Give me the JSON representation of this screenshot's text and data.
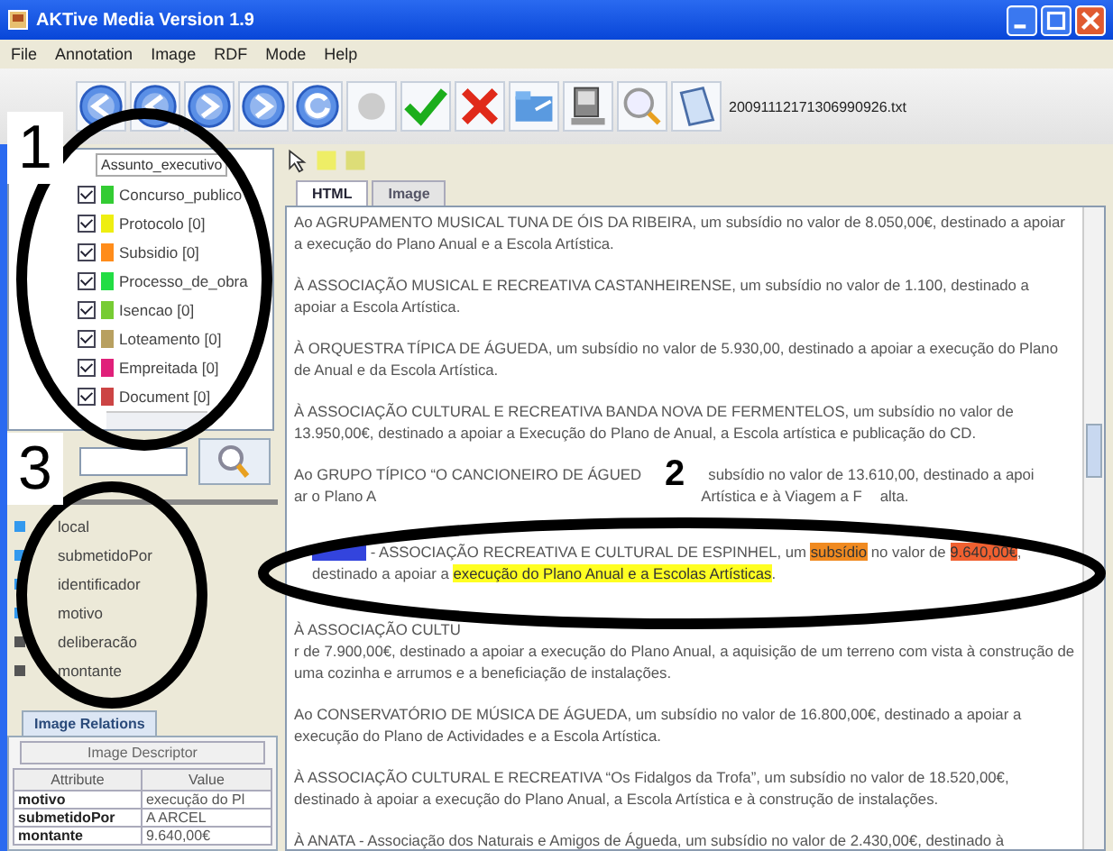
{
  "window": {
    "title": "AKTive Media Version 1.9"
  },
  "menu": [
    "File",
    "Annotation",
    "Image",
    "RDF",
    "Mode",
    "Help"
  ],
  "toolbar": {
    "filename": "20091112171306990926.txt"
  },
  "tree": {
    "header": "Assunto_executivo",
    "items": [
      {
        "label": "Concurso_publico",
        "checked": true,
        "color": "#33cc33"
      },
      {
        "label": "Protocolo [0]",
        "checked": true,
        "color": "#eeee11"
      },
      {
        "label": "Subsidio [0]",
        "checked": true,
        "color": "#ff8c1a"
      },
      {
        "label": "Processo_de_obra",
        "checked": true,
        "color": "#22dd44"
      },
      {
        "label": "Isencao [0]",
        "checked": true,
        "color": "#77cc33"
      },
      {
        "label": "Loteamento [0]",
        "checked": true,
        "color": "#b8a060"
      },
      {
        "label": "Empreitada [0]",
        "checked": true,
        "color": "#e0207a"
      },
      {
        "label": "Document [0]",
        "checked": true,
        "color": "#cc4444"
      }
    ]
  },
  "attributes": [
    {
      "label": "local",
      "color": "#3399ee"
    },
    {
      "label": "submetidoPor",
      "color": "#3399ee"
    },
    {
      "label": "identificador",
      "color": "#3399ee"
    },
    {
      "label": "motivo",
      "color": "#3399ee"
    },
    {
      "label": "deliberacão",
      "color": "#555555"
    },
    {
      "label": "montante",
      "color": "#555555"
    }
  ],
  "relations": {
    "tab": "Image Relations",
    "button": "Image Descriptor",
    "columns": [
      "Attribute",
      "Value"
    ],
    "rows": [
      [
        "motivo",
        "execução do Pl"
      ],
      [
        "submetidoPor",
        "A ARCEL"
      ],
      [
        "montante",
        "9.640,00€"
      ]
    ]
  },
  "tabs": [
    {
      "label": "HTML",
      "selected": true
    },
    {
      "label": "Image",
      "selected": false
    }
  ],
  "paragraphs": [
    {
      "kind": "plain",
      "text": "Ao AGRUPAMENTO MUSICAL TUNA DE ÓIS DA RIBEIRA, um subsídio no valor de 8.050,00€, destinado a apoiar a execução do Plano Anual e a Escola Artística."
    },
    {
      "kind": "plain",
      "text": "À ASSOCIAÇÃO MUSICAL E RECREATIVA CASTANHEIRENSE, um subsídio no valor de 1.100, destinado a apoiar a Escola Artística."
    },
    {
      "kind": "plain",
      "text": "À ORQUESTRA TÍPICA DE ÁGUEDA, um subsídio no valor de 5.930,00, destinado a apoiar a execução do Plano de Anual e da Escola Artística."
    },
    {
      "kind": "plain",
      "text": "À ASSOCIAÇÃO CULTURAL E RECREATIVA BANDA NOVA DE FERMENTELOS, um subsídio no valor de 13.950,00€, destinado a apoiar a Execução do Plano de Anual, a Escola artística e publicação do CD."
    },
    {
      "kind": "lines",
      "lines": [
        [
          {
            "kind": "text",
            "text": "Ao GRUPO TÍPICO “O CANCIONEIRO DE ÁGUED"
          },
          {
            "kind": "callout",
            "label": "2"
          },
          {
            "kind": "text",
            "text": "subsídio no valor de 13.610,00, destinado a apoi"
          }
        ],
        [
          {
            "kind": "text",
            "text": "ar o Plano A"
          },
          {
            "kind": "text",
            "text": "Artística e à Viagem a F"
          },
          {
            "kind": "text",
            "text": "alta."
          }
        ]
      ]
    },
    {
      "kind": "annotated",
      "lines": [
        [
          {
            "kind": "mark",
            "color": "#3344dd"
          },
          {
            "kind": "text",
            "text": " - ASSOCIAÇÃO RECREATIVA E CULTURAL DE ESPINHEL, um "
          },
          {
            "kind": "highlight",
            "text": "subsídio",
            "color": "#f08a20"
          },
          {
            "kind": "text",
            "text": " no valor de "
          },
          {
            "kind": "highlight",
            "text": "9.640,00€",
            "color": "#f06030"
          },
          {
            "kind": "text",
            "text": ","
          }
        ],
        [
          {
            "kind": "text",
            "text": "destinado a apoiar a "
          },
          {
            "kind": "highlight",
            "text": "execução do Plano Anual e a Escolas Artísticas",
            "color": "#ffff22"
          },
          {
            "kind": "text",
            "text": "."
          }
        ]
      ]
    },
    {
      "kind": "fragments",
      "parts": [
        "À ASSOCIAÇÃO CULTU",
        "r de 7.900,00€, destinado a apoiar a execução do Plano Anual, a aquisição de um terreno com vista à construção de uma cozinha e arrumos e a beneficiação de instalações."
      ]
    },
    {
      "kind": "plain",
      "text": "Ao CONSERVATÓRIO DE MÚSICA DE ÁGUEDA, um subsídio no valor de 16.800,00€, destinado a apoiar a execução do Plano de Actividades e a Escola Artística."
    },
    {
      "kind": "plain",
      "text": "À ASSOCIAÇÃO CULTURAL E RECREATIVA “Os Fidalgos da Trofa”, um subsídio no valor de 18.520,00€, destinado à apoiar a execução do Plano Anual, a Escola Artística e à construção de instalações."
    },
    {
      "kind": "plain",
      "text": "À ANATA - Associação dos Naturais e Amigos de Águeda, um subsídio no valor de 2.430,00€, destinado à"
    }
  ],
  "callouts": [
    {
      "label": "1"
    },
    {
      "label": "3"
    }
  ]
}
